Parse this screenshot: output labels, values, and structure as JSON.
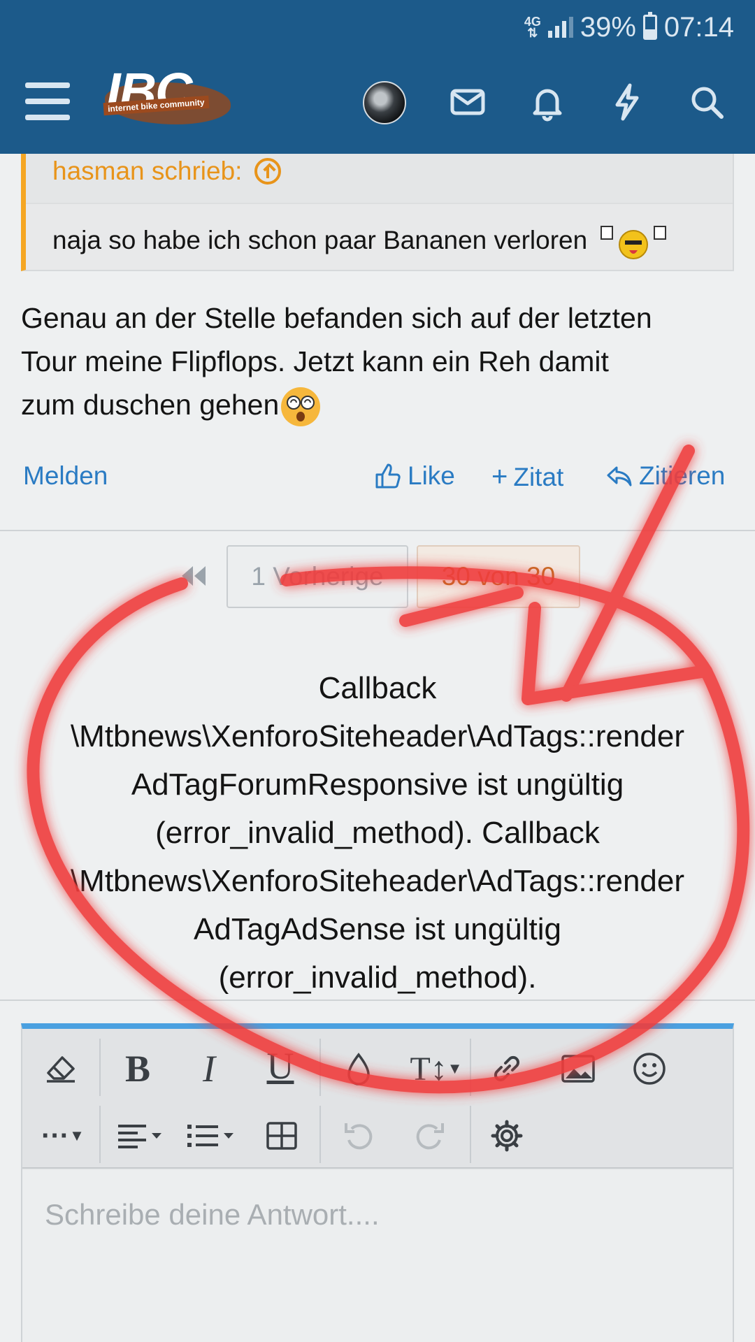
{
  "status_bar": {
    "network": "4G",
    "battery": "39%",
    "time": "07:14"
  },
  "header": {
    "logo_text": "IBC",
    "logo_subtitle": "internet bike community",
    "icons": [
      "menu-icon",
      "avatar",
      "mail-icon",
      "bell-icon",
      "bolt-icon",
      "search-icon"
    ]
  },
  "quote": {
    "author_line": "hasman schrieb:",
    "text": "naja so habe ich schon paar Bananen verloren"
  },
  "post": {
    "lines": [
      "Genau an der Stelle befanden sich auf der letzten",
      "Tour meine Flipflops. Jetzt kann ein Reh damit",
      "zum duschen gehen"
    ]
  },
  "actions": {
    "report": "Melden",
    "like": "Like",
    "plus_quote": "Zitat",
    "reply_quote": "Zitieren"
  },
  "pagination": {
    "prev_label": "1 Vorherige",
    "current_label": "30 von 30"
  },
  "error": {
    "lines": [
      "Callback",
      "\\Mtbnews\\XenforoSiteheader\\AdTags::render",
      "AdTagForumResponsive ist ungültig",
      "(error_invalid_method). Callback",
      "\\Mtbnews\\XenforoSiteheader\\AdTags::render",
      "AdTagAdSense ist ungültig",
      "(error_invalid_method)."
    ]
  },
  "editor": {
    "placeholder": "Schreibe deine Antwort....",
    "accent_color": "#4aa0e0"
  },
  "colors": {
    "header_bg": "#1c5a8a",
    "link": "#2a7bc3",
    "quote_accent": "#f5a623",
    "annotation": "#f03c3c"
  }
}
